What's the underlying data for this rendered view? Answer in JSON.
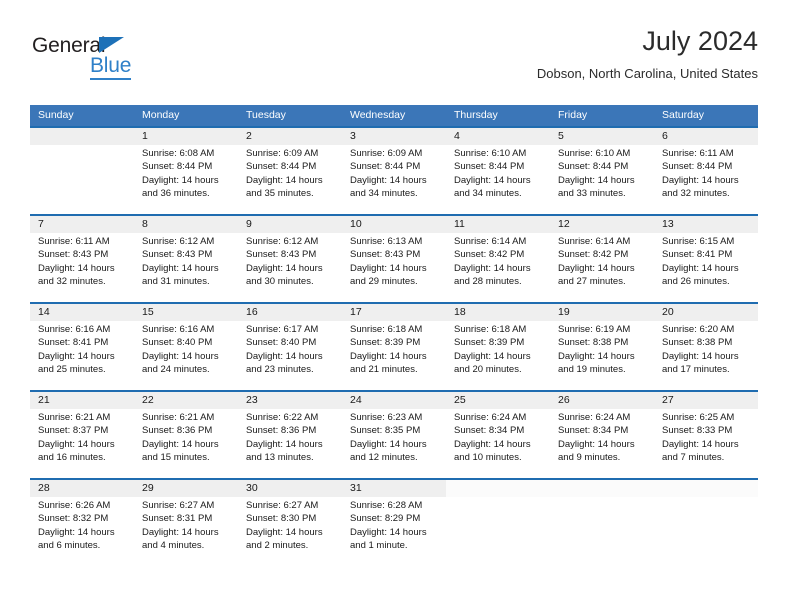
{
  "brand": {
    "name_part1": "General",
    "name_part2": "Blue",
    "triangle_icon": "triangle-icon",
    "accent_blue": "#2f80c8",
    "logo_dark": "#221f20"
  },
  "header": {
    "title": "July 2024",
    "subtitle": "Dobson, North Carolina, United States"
  },
  "calendar": {
    "header_bg": "#3b76b8",
    "row_divider": "#1f6cb0",
    "daynum_band_bg": "#efefef",
    "weekdays": [
      "Sunday",
      "Monday",
      "Tuesday",
      "Wednesday",
      "Thursday",
      "Friday",
      "Saturday"
    ],
    "weeks": [
      [
        {
          "day": "",
          "sunrise": "",
          "sunset": "",
          "daylight1": "",
          "daylight2": ""
        },
        {
          "day": "1",
          "sunrise": "Sunrise: 6:08 AM",
          "sunset": "Sunset: 8:44 PM",
          "daylight1": "Daylight: 14 hours",
          "daylight2": "and 36 minutes."
        },
        {
          "day": "2",
          "sunrise": "Sunrise: 6:09 AM",
          "sunset": "Sunset: 8:44 PM",
          "daylight1": "Daylight: 14 hours",
          "daylight2": "and 35 minutes."
        },
        {
          "day": "3",
          "sunrise": "Sunrise: 6:09 AM",
          "sunset": "Sunset: 8:44 PM",
          "daylight1": "Daylight: 14 hours",
          "daylight2": "and 34 minutes."
        },
        {
          "day": "4",
          "sunrise": "Sunrise: 6:10 AM",
          "sunset": "Sunset: 8:44 PM",
          "daylight1": "Daylight: 14 hours",
          "daylight2": "and 34 minutes."
        },
        {
          "day": "5",
          "sunrise": "Sunrise: 6:10 AM",
          "sunset": "Sunset: 8:44 PM",
          "daylight1": "Daylight: 14 hours",
          "daylight2": "and 33 minutes."
        },
        {
          "day": "6",
          "sunrise": "Sunrise: 6:11 AM",
          "sunset": "Sunset: 8:44 PM",
          "daylight1": "Daylight: 14 hours",
          "daylight2": "and 32 minutes."
        }
      ],
      [
        {
          "day": "7",
          "sunrise": "Sunrise: 6:11 AM",
          "sunset": "Sunset: 8:43 PM",
          "daylight1": "Daylight: 14 hours",
          "daylight2": "and 32 minutes."
        },
        {
          "day": "8",
          "sunrise": "Sunrise: 6:12 AM",
          "sunset": "Sunset: 8:43 PM",
          "daylight1": "Daylight: 14 hours",
          "daylight2": "and 31 minutes."
        },
        {
          "day": "9",
          "sunrise": "Sunrise: 6:12 AM",
          "sunset": "Sunset: 8:43 PM",
          "daylight1": "Daylight: 14 hours",
          "daylight2": "and 30 minutes."
        },
        {
          "day": "10",
          "sunrise": "Sunrise: 6:13 AM",
          "sunset": "Sunset: 8:43 PM",
          "daylight1": "Daylight: 14 hours",
          "daylight2": "and 29 minutes."
        },
        {
          "day": "11",
          "sunrise": "Sunrise: 6:14 AM",
          "sunset": "Sunset: 8:42 PM",
          "daylight1": "Daylight: 14 hours",
          "daylight2": "and 28 minutes."
        },
        {
          "day": "12",
          "sunrise": "Sunrise: 6:14 AM",
          "sunset": "Sunset: 8:42 PM",
          "daylight1": "Daylight: 14 hours",
          "daylight2": "and 27 minutes."
        },
        {
          "day": "13",
          "sunrise": "Sunrise: 6:15 AM",
          "sunset": "Sunset: 8:41 PM",
          "daylight1": "Daylight: 14 hours",
          "daylight2": "and 26 minutes."
        }
      ],
      [
        {
          "day": "14",
          "sunrise": "Sunrise: 6:16 AM",
          "sunset": "Sunset: 8:41 PM",
          "daylight1": "Daylight: 14 hours",
          "daylight2": "and 25 minutes."
        },
        {
          "day": "15",
          "sunrise": "Sunrise: 6:16 AM",
          "sunset": "Sunset: 8:40 PM",
          "daylight1": "Daylight: 14 hours",
          "daylight2": "and 24 minutes."
        },
        {
          "day": "16",
          "sunrise": "Sunrise: 6:17 AM",
          "sunset": "Sunset: 8:40 PM",
          "daylight1": "Daylight: 14 hours",
          "daylight2": "and 23 minutes."
        },
        {
          "day": "17",
          "sunrise": "Sunrise: 6:18 AM",
          "sunset": "Sunset: 8:39 PM",
          "daylight1": "Daylight: 14 hours",
          "daylight2": "and 21 minutes."
        },
        {
          "day": "18",
          "sunrise": "Sunrise: 6:18 AM",
          "sunset": "Sunset: 8:39 PM",
          "daylight1": "Daylight: 14 hours",
          "daylight2": "and 20 minutes."
        },
        {
          "day": "19",
          "sunrise": "Sunrise: 6:19 AM",
          "sunset": "Sunset: 8:38 PM",
          "daylight1": "Daylight: 14 hours",
          "daylight2": "and 19 minutes."
        },
        {
          "day": "20",
          "sunrise": "Sunrise: 6:20 AM",
          "sunset": "Sunset: 8:38 PM",
          "daylight1": "Daylight: 14 hours",
          "daylight2": "and 17 minutes."
        }
      ],
      [
        {
          "day": "21",
          "sunrise": "Sunrise: 6:21 AM",
          "sunset": "Sunset: 8:37 PM",
          "daylight1": "Daylight: 14 hours",
          "daylight2": "and 16 minutes."
        },
        {
          "day": "22",
          "sunrise": "Sunrise: 6:21 AM",
          "sunset": "Sunset: 8:36 PM",
          "daylight1": "Daylight: 14 hours",
          "daylight2": "and 15 minutes."
        },
        {
          "day": "23",
          "sunrise": "Sunrise: 6:22 AM",
          "sunset": "Sunset: 8:36 PM",
          "daylight1": "Daylight: 14 hours",
          "daylight2": "and 13 minutes."
        },
        {
          "day": "24",
          "sunrise": "Sunrise: 6:23 AM",
          "sunset": "Sunset: 8:35 PM",
          "daylight1": "Daylight: 14 hours",
          "daylight2": "and 12 minutes."
        },
        {
          "day": "25",
          "sunrise": "Sunrise: 6:24 AM",
          "sunset": "Sunset: 8:34 PM",
          "daylight1": "Daylight: 14 hours",
          "daylight2": "and 10 minutes."
        },
        {
          "day": "26",
          "sunrise": "Sunrise: 6:24 AM",
          "sunset": "Sunset: 8:34 PM",
          "daylight1": "Daylight: 14 hours",
          "daylight2": "and 9 minutes."
        },
        {
          "day": "27",
          "sunrise": "Sunrise: 6:25 AM",
          "sunset": "Sunset: 8:33 PM",
          "daylight1": "Daylight: 14 hours",
          "daylight2": "and 7 minutes."
        }
      ],
      [
        {
          "day": "28",
          "sunrise": "Sunrise: 6:26 AM",
          "sunset": "Sunset: 8:32 PM",
          "daylight1": "Daylight: 14 hours",
          "daylight2": "and 6 minutes."
        },
        {
          "day": "29",
          "sunrise": "Sunrise: 6:27 AM",
          "sunset": "Sunset: 8:31 PM",
          "daylight1": "Daylight: 14 hours",
          "daylight2": "and 4 minutes."
        },
        {
          "day": "30",
          "sunrise": "Sunrise: 6:27 AM",
          "sunset": "Sunset: 8:30 PM",
          "daylight1": "Daylight: 14 hours",
          "daylight2": "and 2 minutes."
        },
        {
          "day": "31",
          "sunrise": "Sunrise: 6:28 AM",
          "sunset": "Sunset: 8:29 PM",
          "daylight1": "Daylight: 14 hours",
          "daylight2": "and 1 minute."
        },
        {
          "day": "",
          "sunrise": "",
          "sunset": "",
          "daylight1": "",
          "daylight2": ""
        },
        {
          "day": "",
          "sunrise": "",
          "sunset": "",
          "daylight1": "",
          "daylight2": ""
        },
        {
          "day": "",
          "sunrise": "",
          "sunset": "",
          "daylight1": "",
          "daylight2": ""
        }
      ]
    ]
  }
}
